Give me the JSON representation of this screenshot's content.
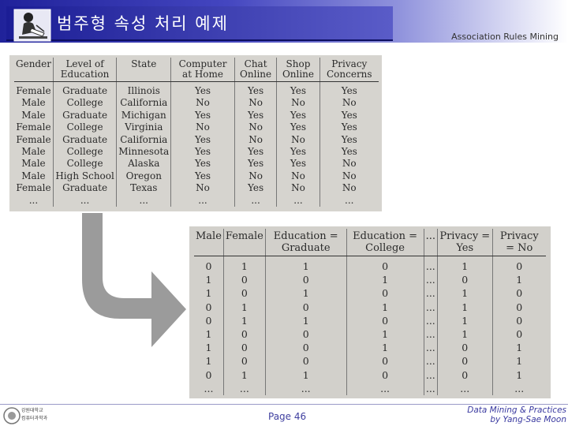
{
  "header": {
    "title": "범주형 속성 처리 예제",
    "subtitle": "Association Rules Mining"
  },
  "table1": {
    "columns": [
      "Gender",
      "Level of Education",
      "State",
      "Computer at Home",
      "Chat Online",
      "Shop Online",
      "Privacy Concerns"
    ],
    "rows": [
      [
        "Female",
        "Graduate",
        "Illinois",
        "Yes",
        "Yes",
        "Yes",
        "Yes"
      ],
      [
        "Male",
        "College",
        "California",
        "No",
        "No",
        "No",
        "No"
      ],
      [
        "Male",
        "Graduate",
        "Michigan",
        "Yes",
        "Yes",
        "Yes",
        "Yes"
      ],
      [
        "Female",
        "College",
        "Virginia",
        "No",
        "No",
        "Yes",
        "Yes"
      ],
      [
        "Female",
        "Graduate",
        "California",
        "Yes",
        "No",
        "No",
        "Yes"
      ],
      [
        "Male",
        "College",
        "Minnesota",
        "Yes",
        "Yes",
        "Yes",
        "Yes"
      ],
      [
        "Male",
        "College",
        "Alaska",
        "Yes",
        "Yes",
        "Yes",
        "No"
      ],
      [
        "Male",
        "High School",
        "Oregon",
        "Yes",
        "No",
        "No",
        "No"
      ],
      [
        "Female",
        "Graduate",
        "Texas",
        "No",
        "Yes",
        "No",
        "No"
      ],
      [
        "...",
        "...",
        "...",
        "...",
        "...",
        "...",
        "..."
      ]
    ]
  },
  "table2": {
    "columns": [
      "Male",
      "Female",
      "Education = Graduate",
      "Education = College",
      "...",
      "Privacy = Yes",
      "Privacy = No"
    ],
    "rows": [
      [
        "0",
        "1",
        "1",
        "0",
        "...",
        "1",
        "0"
      ],
      [
        "1",
        "0",
        "0",
        "1",
        "...",
        "0",
        "1"
      ],
      [
        "1",
        "0",
        "1",
        "0",
        "...",
        "1",
        "0"
      ],
      [
        "0",
        "1",
        "0",
        "1",
        "...",
        "1",
        "0"
      ],
      [
        "0",
        "1",
        "1",
        "0",
        "...",
        "1",
        "0"
      ],
      [
        "1",
        "0",
        "0",
        "1",
        "...",
        "1",
        "0"
      ],
      [
        "1",
        "0",
        "0",
        "1",
        "...",
        "0",
        "1"
      ],
      [
        "1",
        "0",
        "0",
        "0",
        "...",
        "0",
        "1"
      ],
      [
        "0",
        "1",
        "1",
        "0",
        "...",
        "0",
        "1"
      ],
      [
        "...",
        "...",
        "...",
        "...",
        "...",
        "...",
        "..."
      ]
    ]
  },
  "footer": {
    "page": "Page 46",
    "course_line1": "Data Mining & Practices",
    "course_line2": "by Yang-Sae Moon",
    "logo_line1": "강원대학교",
    "logo_line2": "컴퓨터과학과"
  },
  "colors": {
    "title_bar": "#20229a",
    "arrow": "#9b9b9b",
    "footer_text": "#3a3aa0"
  }
}
